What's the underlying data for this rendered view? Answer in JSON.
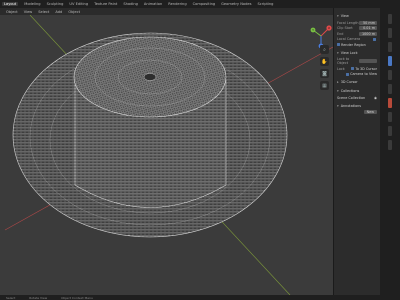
{
  "topbar": {
    "tabs": [
      "Layout",
      "Modeling",
      "Sculpting",
      "UV Editing",
      "Texture Paint",
      "Shading",
      "Animation",
      "Rendering",
      "Compositing",
      "Geometry Nodes",
      "Scripting"
    ]
  },
  "header": {
    "menus": [
      "Object",
      "View",
      "Select",
      "Add",
      "Object"
    ]
  },
  "gizmo": {
    "x": "X",
    "y": "Y",
    "z": "Z",
    "colors": {
      "x": "#e04a4a",
      "y": "#7ac043",
      "z": "#4a7de0"
    }
  },
  "sidebar": {
    "sec_view": "View",
    "focal_label": "Focal Length",
    "focal_value": "50 mm",
    "clip_start_label": "Clip Start",
    "clip_start_value": "0.01 m",
    "clip_end_label": "End",
    "clip_end_value": "1000 m",
    "local_camera_label": "Local Camera",
    "render_region_label": "Render Region",
    "sec_view_lock": "View Lock",
    "lock_to_object_label": "Lock to Object",
    "lock_label": "Lock",
    "lock_cursor_label": "To 3D Cursor",
    "lock_camera_label": "Camera to View",
    "sec_3d_cursor": "3D Cursor",
    "sec_collections": "Collections",
    "collection_item": "Scene Collection",
    "sec_annotations": "Annotations",
    "annotation_new": "New"
  },
  "status": {
    "items": [
      "Select",
      "Rotate View",
      "Object Context Menu"
    ]
  },
  "colors": {
    "mesh": "#d9d9d9",
    "axis_x": "#b04848",
    "axis_y": "#7e9a3a",
    "accent": "#4a78c4"
  }
}
